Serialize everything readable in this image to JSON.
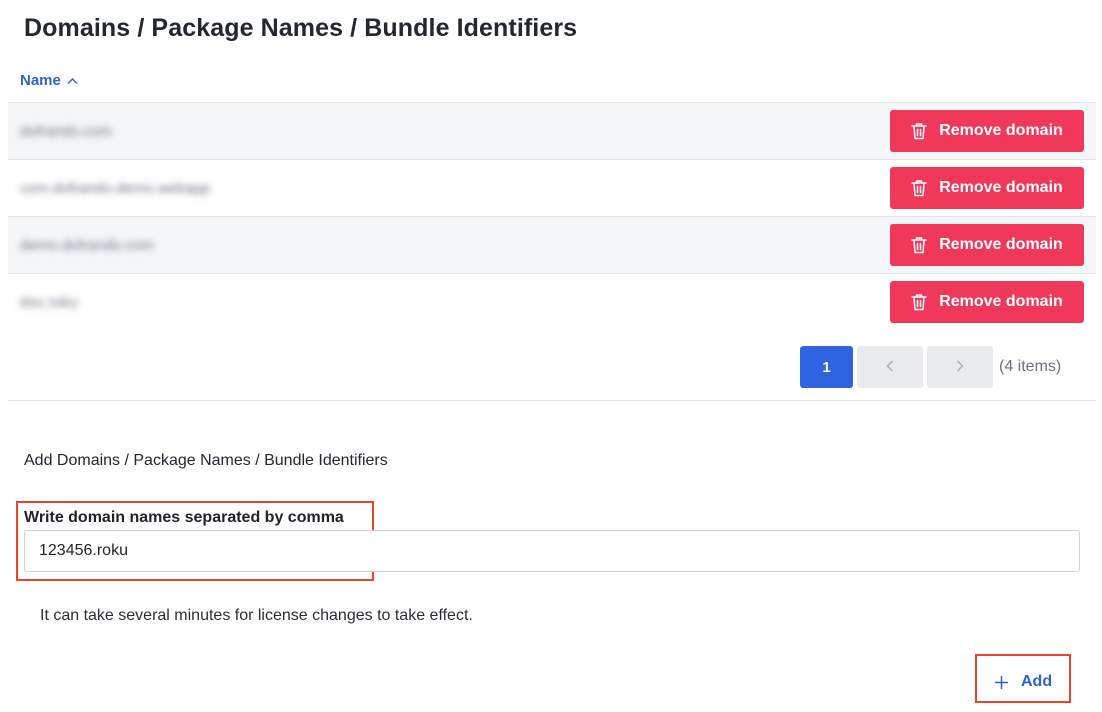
{
  "page": {
    "title": "Domains / Package Names / Bundle Identifiers"
  },
  "table": {
    "column_header": "Name",
    "sort": "ascending",
    "rows": [
      {
        "domain": "dofrando.com",
        "action_label": "Remove domain"
      },
      {
        "domain": "com.dofrando.demo.webapp",
        "action_label": "Remove domain"
      },
      {
        "domain": "demo.dofrando.com",
        "action_label": "Remove domain"
      },
      {
        "domain": "doc.roku",
        "action_label": "Remove domain"
      }
    ]
  },
  "pagination": {
    "current_page": "1",
    "prev_icon": "chevron-left-icon",
    "next_icon": "chevron-right-icon",
    "info": "(4 items)"
  },
  "add_section": {
    "title": "Add Domains / Package Names / Bundle Identifiers",
    "field_label": "Write domain names separated by comma",
    "field_value": "123456.roku",
    "help_text": "It can take several minutes for license changes to take effect.",
    "add_button_label": "Add"
  },
  "colors": {
    "accent_blue": "#2f63c5",
    "primary_blue": "#2f63e0",
    "danger_red": "#f0385a",
    "highlight_red": "#e8452c"
  }
}
